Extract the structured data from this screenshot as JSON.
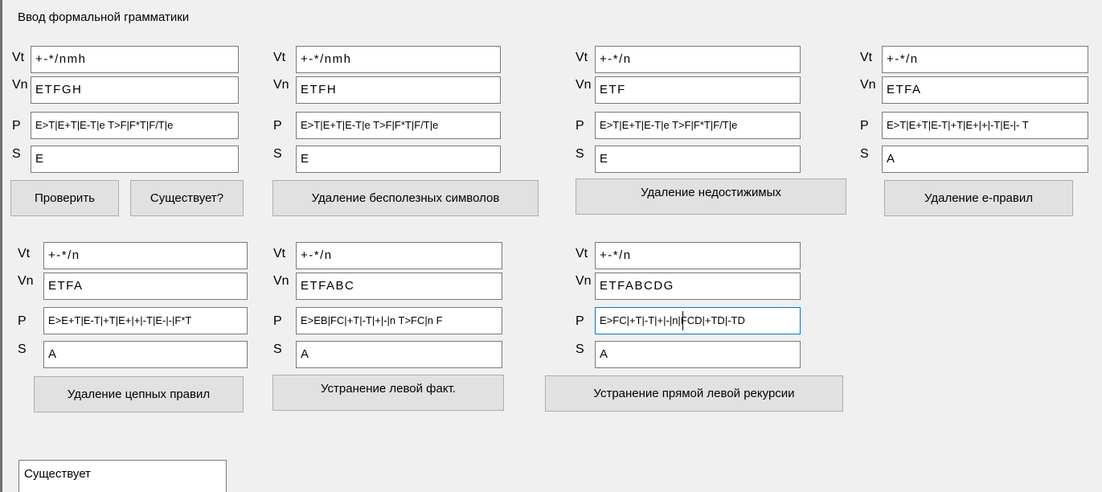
{
  "window": {
    "title": "Ввод формальной грамматики"
  },
  "labels": {
    "vt": "Vt",
    "vn": "Vn",
    "p": "P",
    "s": "S"
  },
  "panels": [
    {
      "vt": "+-*/nmh",
      "vn": "ETFGH",
      "p": "E>T|E+T|E-T|e T>F|F*T|F/T|e",
      "s": "E"
    },
    {
      "vt": "+-*/nmh",
      "vn": "ETFH",
      "p": "E>T|E+T|E-T|e T>F|F*T|F/T|e",
      "s": "E"
    },
    {
      "vt": "+-*/n",
      "vn": "ETF",
      "p": "E>T|E+T|E-T|e T>F|F*T|F/T|e",
      "s": "E"
    },
    {
      "vt": "+-*/n",
      "vn": "ETFA",
      "p": "E>T|E+T|E-T|+T|E+|+|-T|E-|- T",
      "s": "A"
    },
    {
      "vt": "+-*/n",
      "vn": "ETFA",
      "p": "E>E+T|E-T|+T|E+|+|-T|E-|-|F*T",
      "s": "A"
    },
    {
      "vt": "+-*/n",
      "vn": "ETFABC",
      "p": "E>EB|FC|+T|-T|+|-|n T>FC|n F",
      "s": "A"
    },
    {
      "vt": "+-*/n",
      "vn": "ETFABCDG",
      "p": "E>FC|+T|-T|+|-|n|FCD|+TD|-TD",
      "s": "A"
    }
  ],
  "buttons": {
    "check": "Проверить",
    "exists": "Существует?",
    "remove_useless": "Удаление бесполезных символов",
    "remove_unreachable": "Удаление недостижимых",
    "remove_e_rules": "Удаление е-правил",
    "remove_chain_rules": "Удаление цепных правил",
    "left_factoring": "Устранение левой факт.",
    "left_recursion": "Устранение прямой левой рекурсии"
  },
  "result": {
    "text": "Существует"
  }
}
